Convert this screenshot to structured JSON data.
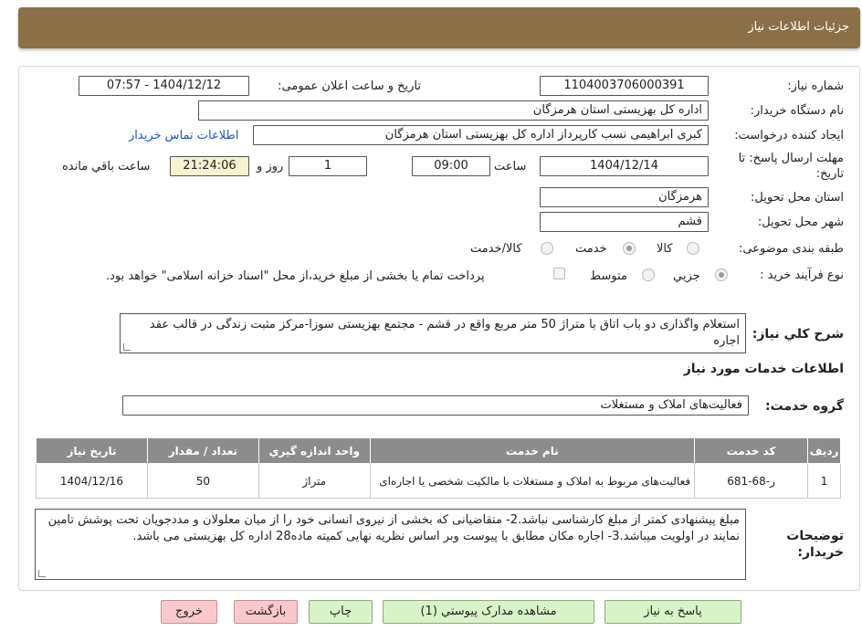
{
  "header": {
    "title": "جزئیات اطلاعات نیاز"
  },
  "form": {
    "need_number_label": "شماره نیاز:",
    "need_number": "1104003706000391",
    "announce_label": "تاریخ و ساعت اعلان عمومی:",
    "announce_value": "1404/12/12 - 07:57",
    "buyer_org_label": "نام دستگاه خریدار:",
    "buyer_org": "اداره کل بهزیستی استان هرمزگان",
    "creator_label": "ایجاد کننده درخواست:",
    "creator": "کبری  ابراهیمی نسب کارپرداز اداره کل بهزیستی استان هرمزگان",
    "contact_link": "اطلاعات تماس خریدار",
    "deadline_label": "مهلت ارسال پاسخ: تا تاریخ:",
    "deadline_date": "1404/12/14",
    "time_label": "ساعت",
    "deadline_time": "09:00",
    "days_value": "1",
    "days_label": "روز و",
    "remaining_time": "21:24:06",
    "remaining_label": "ساعت باقي مانده",
    "province_label": "استان محل تحویل:",
    "province": "هرمزگان",
    "city_label": "شهر محل تحویل:",
    "city": "قشم",
    "category_label": "طبقه بندی موضوعی:",
    "category_options": [
      "کالا",
      "خدمت",
      "کالا/خدمت"
    ],
    "category_selected": "خدمت",
    "purchase_type_label": "نوع فرآیند خرید :",
    "purchase_options": [
      "جزیي",
      "متوسط"
    ],
    "purchase_selected": "جزیي",
    "payment_note": "پرداخت تمام یا بخشی از مبلغ خرید،از محل \"اسناد خزانه اسلامی\" خواهد بود.",
    "description_label": "شرح کلي نياز:",
    "description": "استعلام واگذاری دو باب اتاق با متراژ 50 متر مربع واقع در قشم - مجتمع بهزیستی سوزا-مرکز مثبت زندگی در قالب عقد اجاره"
  },
  "services": {
    "section_title": "اطلاعات خدمات مورد نياز",
    "group_label": "گروه خدمت:",
    "group_value": "فعالیت‌های  املاک و مستغلات",
    "columns": [
      "رديف",
      "کد خدمت",
      "نام خدمت",
      "واحد اندازه گيري",
      "تعداد / مقدار",
      "تاريخ نياز"
    ],
    "rows": [
      [
        "1",
        "ر-68-681",
        "فعالیت‌های مربوط به املاک و مستغلات با مالکیت شخصی یا اجاره‌ای",
        "متراژ",
        "50",
        "1404/12/16"
      ]
    ]
  },
  "buyer_notes": {
    "label": "توضيحات خريدار:",
    "text": "مبلغ پیشنهادی کمتر از مبلغ کارشناسی نباشد.2- متقاضیانی که بخشی از نیروی انسانی خود را از میان معلولان و مددجویان تحت پوشش تامین نمایند در اولویت میباشد.3-  اجاره مکان  مطابق با پیوست وبر اساس نظریه نهایی کمیته ماده28 اداره کل بهزیستی می باشد."
  },
  "buttons": {
    "reply": "پاسخ به نیاز",
    "attachments": "مشاهده مدارک پیوستي (1)",
    "print": "چاپ",
    "back": "بازگشت",
    "exit": "خروج"
  },
  "colors": {
    "header_bg": "#8b6f47",
    "primary_button": "#d9f3c8",
    "danger_button": "#f8c8cc"
  }
}
